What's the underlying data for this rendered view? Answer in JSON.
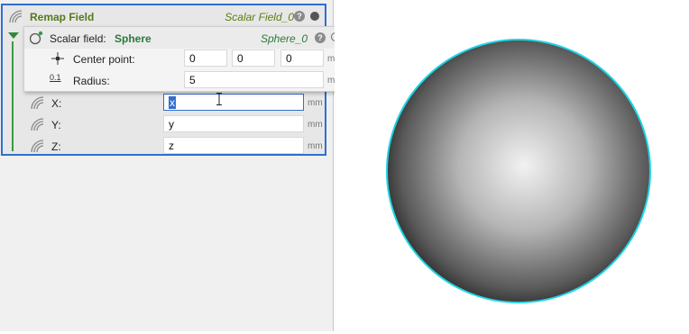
{
  "remap": {
    "title": "Remap Field",
    "instance_name": "Scalar Field_0",
    "help": "?",
    "rows": [
      {
        "label": "X:",
        "value": "x",
        "unit": "mm"
      },
      {
        "label": "Y:",
        "value": "y",
        "unit": "mm"
      },
      {
        "label": "Z:",
        "value": "z",
        "unit": "mm"
      }
    ]
  },
  "scalar": {
    "label": "Scalar field:",
    "value": "Sphere",
    "instance_name": "Sphere_0",
    "help": "?",
    "center": {
      "label": "Center point:",
      "values": [
        "0",
        "0",
        "0"
      ],
      "unit": "mm"
    },
    "radius": {
      "label": "Radius:",
      "icon_text": "0.1",
      "value": "5",
      "unit": "mm"
    }
  },
  "colors": {
    "accent": "#2f6fd0",
    "green_title": "#557a1c",
    "sphere_outline": "#1fd4e4"
  },
  "icons": [
    "field-rings-icon",
    "help-icon",
    "status-dot-icon",
    "expand-arrow-icon",
    "scalar-field-icon",
    "crosshair-icon",
    "radius-icon",
    "text-cursor-icon"
  ]
}
